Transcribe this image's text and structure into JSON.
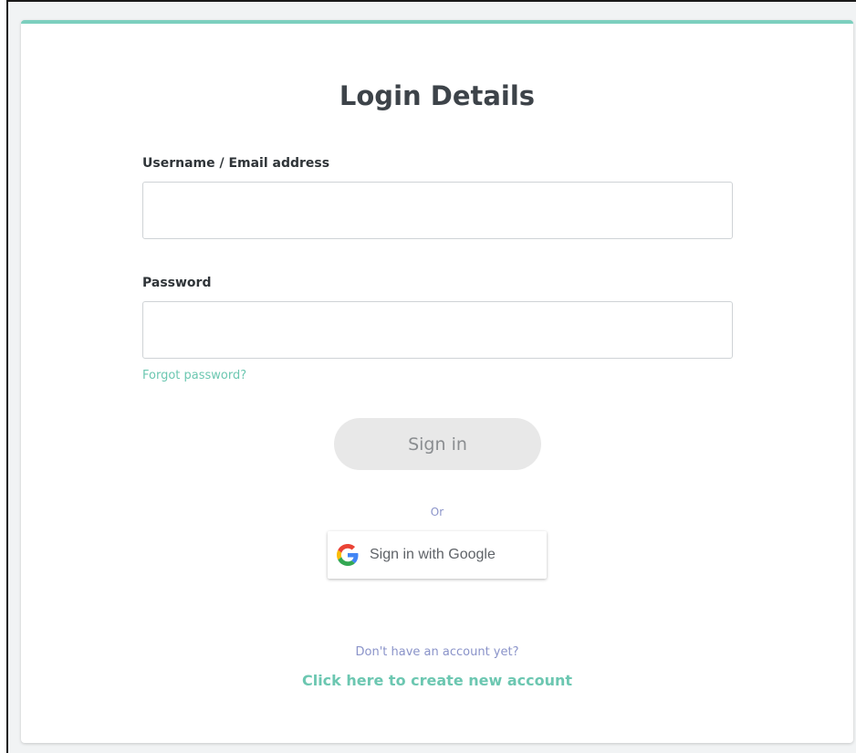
{
  "login": {
    "title": "Login Details",
    "username_label": "Username / Email address",
    "username_value": "",
    "password_label": "Password",
    "password_value": "",
    "forgot_label": "Forgot password?",
    "signin_label": "Sign in",
    "or_label": "Or",
    "google_label": "Sign in with Google",
    "no_account_label": "Don't have an account yet?",
    "create_account_label": "Click here to create new account"
  },
  "colors": {
    "accent": "#7ccfbe",
    "link": "#6cc7b1",
    "muted_link": "#8a93c9",
    "button_disabled_bg": "#e8e8e8",
    "title": "#3d4349"
  },
  "icons": {
    "google": "google-g-icon"
  }
}
